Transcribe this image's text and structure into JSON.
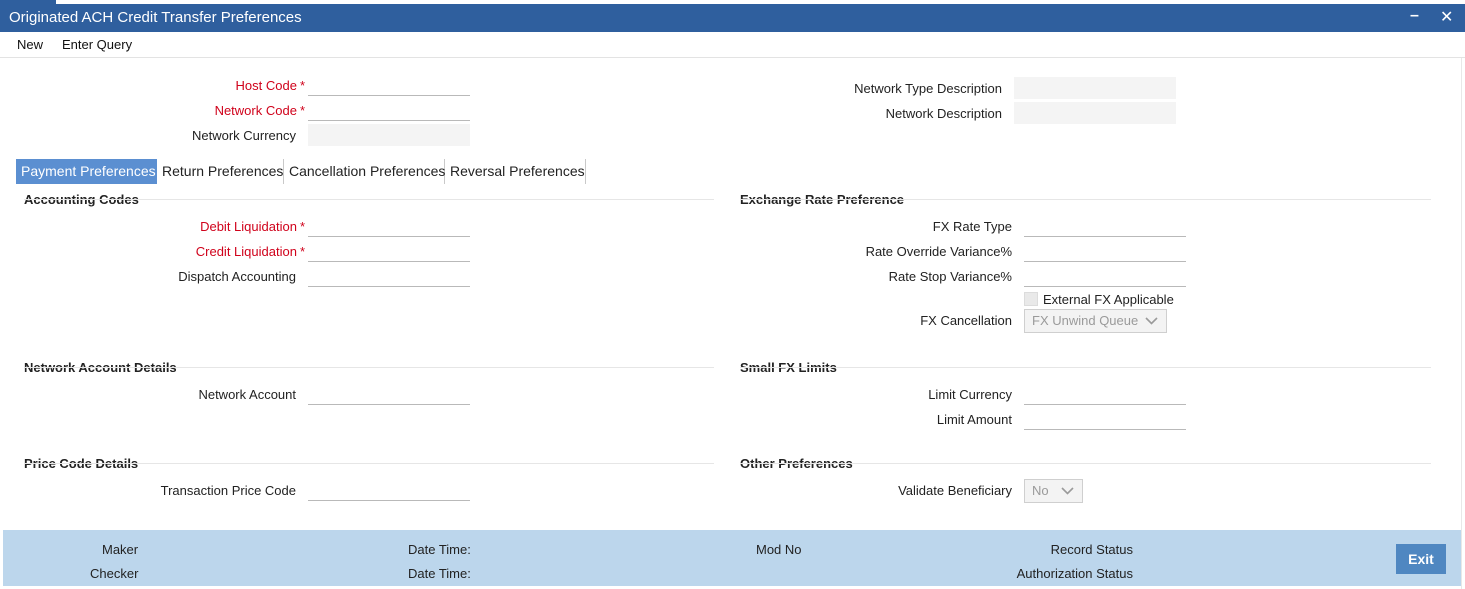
{
  "window": {
    "title": "Originated ACH Credit Transfer Preferences",
    "minimize_glyph": "–",
    "close_glyph": "✕"
  },
  "menu": {
    "new": "New",
    "enter_query": "Enter Query"
  },
  "header": {
    "host_code": {
      "label": "Host Code",
      "value": ""
    },
    "network_code": {
      "label": "Network Code",
      "value": ""
    },
    "network_currency": {
      "label": "Network Currency",
      "value": ""
    },
    "network_type_description": {
      "label": "Network Type Description",
      "value": ""
    },
    "network_description": {
      "label": "Network Description",
      "value": ""
    },
    "required_mark": "*"
  },
  "tabs": [
    {
      "label": "Payment Preferences",
      "active": true
    },
    {
      "label": "Return Preferences",
      "active": false
    },
    {
      "label": "Cancellation Preferences",
      "active": false
    },
    {
      "label": "Reversal Preferences",
      "active": false
    }
  ],
  "accounting_codes": {
    "title": "Accounting Codes",
    "debit_liquidation": {
      "label": "Debit Liquidation",
      "value": ""
    },
    "credit_liquidation": {
      "label": "Credit Liquidation",
      "value": ""
    },
    "dispatch_accounting": {
      "label": "Dispatch Accounting",
      "value": ""
    }
  },
  "exchange_rate": {
    "title": "Exchange Rate Preference",
    "fx_rate_type": {
      "label": "FX Rate Type",
      "value": ""
    },
    "rate_override_variance": {
      "label": "Rate Override Variance%",
      "value": ""
    },
    "rate_stop_variance": {
      "label": "Rate Stop Variance%",
      "value": ""
    },
    "external_fx_applicable": {
      "label": "External FX Applicable",
      "checked": false
    },
    "fx_cancellation": {
      "label": "FX Cancellation",
      "selected": "FX Unwind Queue"
    }
  },
  "network_account": {
    "title": "Network Account Details",
    "network_account": {
      "label": "Network Account",
      "value": ""
    }
  },
  "small_fx": {
    "title": "Small FX Limits",
    "limit_currency": {
      "label": "Limit Currency",
      "value": ""
    },
    "limit_amount": {
      "label": "Limit Amount",
      "value": ""
    }
  },
  "price_code": {
    "title": "Price Code Details",
    "transaction_price_code": {
      "label": "Transaction Price Code",
      "value": ""
    }
  },
  "other_preferences": {
    "title": "Other Preferences",
    "validate_beneficiary": {
      "label": "Validate Beneficiary",
      "selected": "No"
    }
  },
  "footer": {
    "maker": "Maker",
    "checker": "Checker",
    "date_time_1": "Date Time:",
    "date_time_2": "Date Time:",
    "mod_no": "Mod No",
    "record_status": "Record Status",
    "authorization_status": "Authorization Status",
    "exit": "Exit"
  },
  "colors": {
    "title_bar": "#2f5f9e",
    "active_tab": "#5b8fd1",
    "required": "#d0021b",
    "footer": "#bcd6ec",
    "exit_button": "#4f87c1"
  }
}
